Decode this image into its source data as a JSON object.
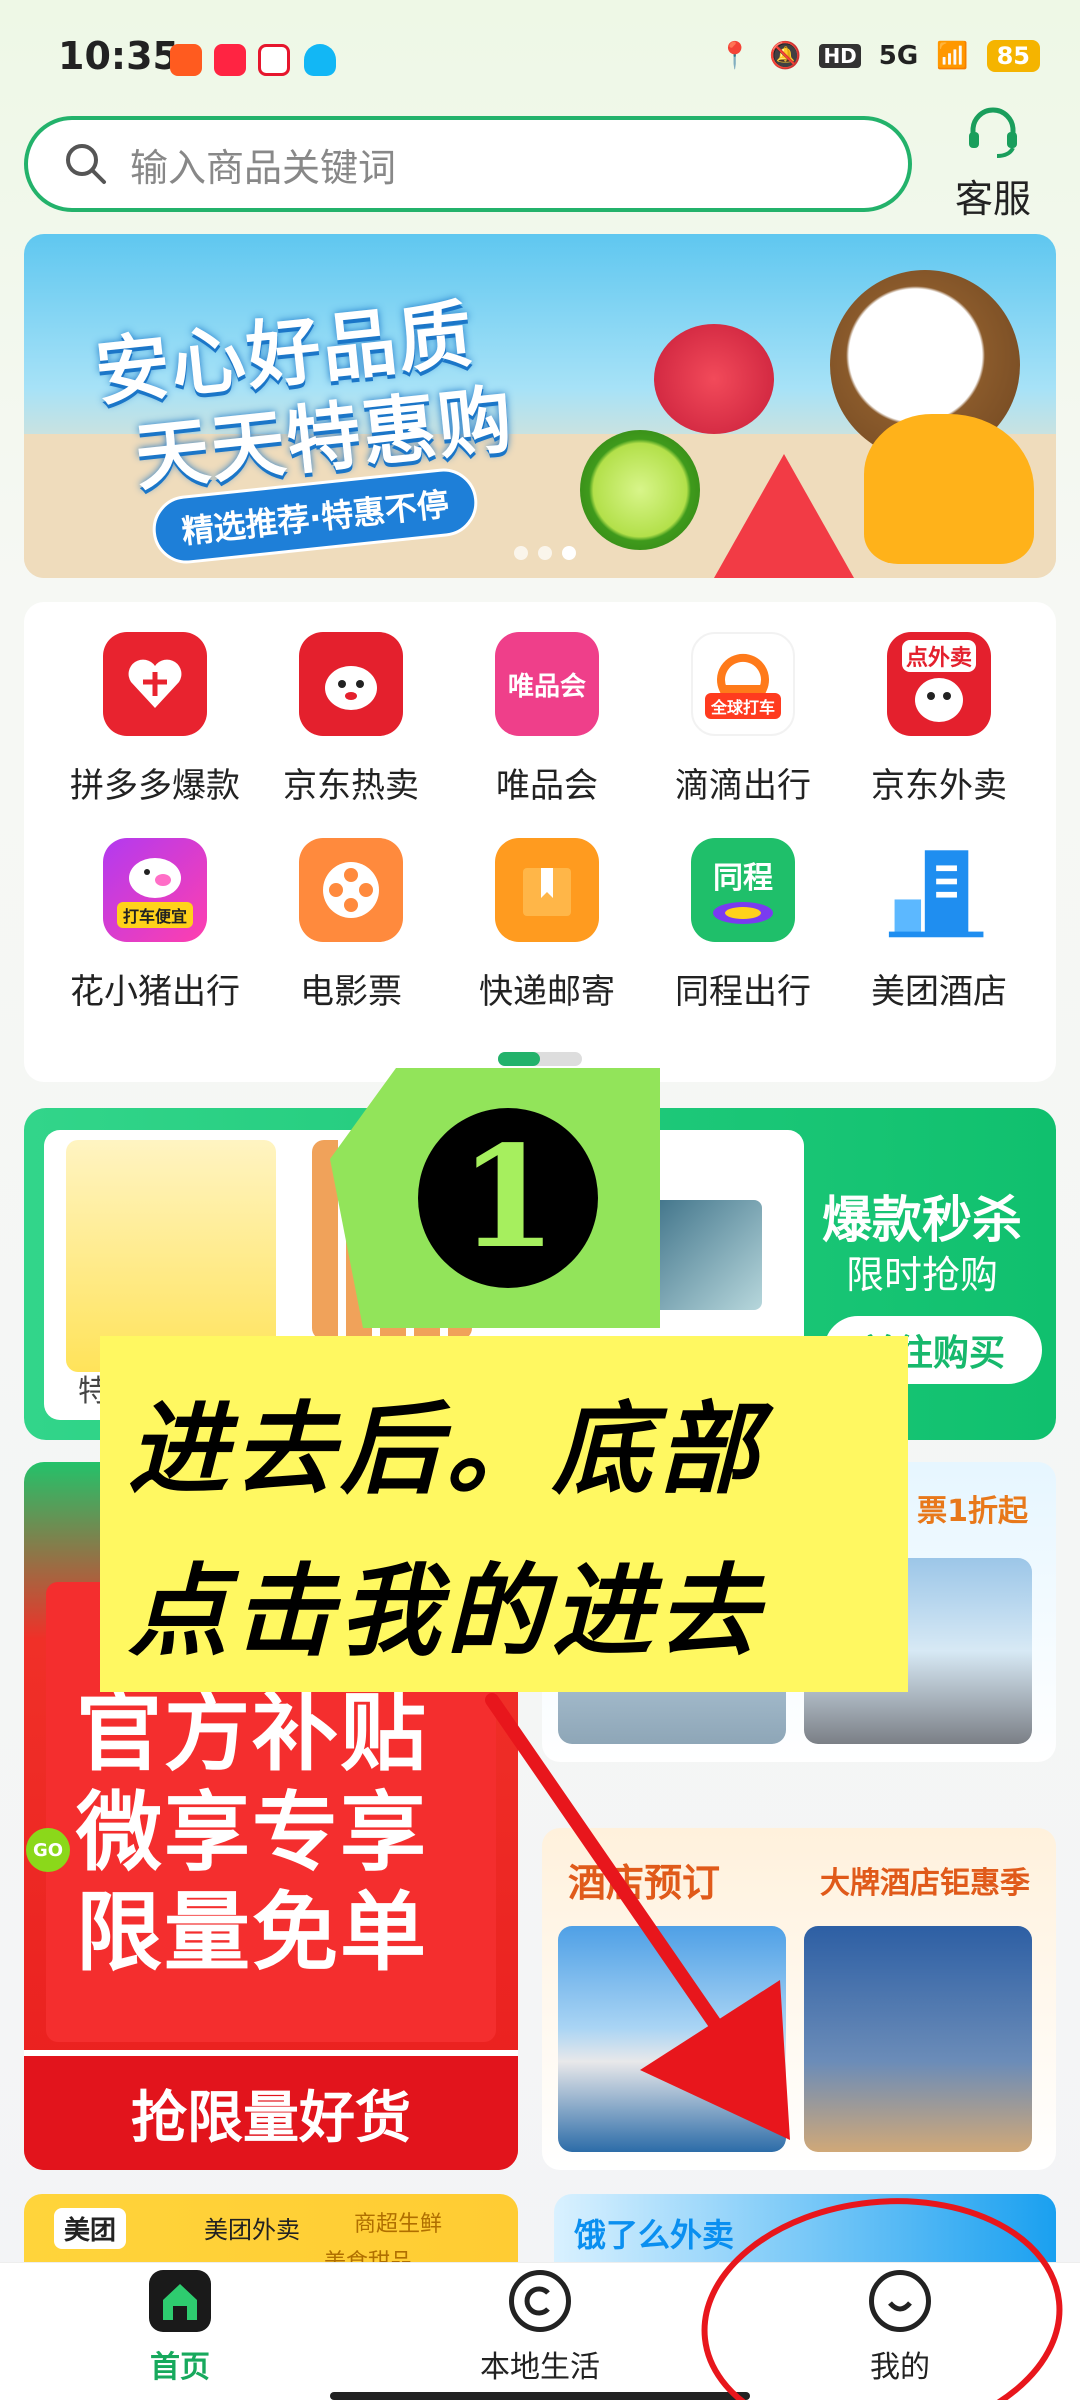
{
  "status": {
    "time": "10:35",
    "battery": "85",
    "network": "5G"
  },
  "search": {
    "placeholder": "输入商品关键词"
  },
  "service": {
    "label": "客服"
  },
  "banner": {
    "line1": "安心好品质",
    "line2": "天天特惠购",
    "tag": "精选推荐·特惠不停"
  },
  "grid": {
    "items": [
      {
        "label": "拼多多爆款",
        "icon": "pinduoduo-icon",
        "color": "#e8232f"
      },
      {
        "label": "京东热卖",
        "icon": "jd-dog-icon",
        "color": "#e4202d"
      },
      {
        "label": "唯品会",
        "icon": "vip-icon",
        "color": "#ef3f8a",
        "text": "唯品会"
      },
      {
        "label": "滴滴出行",
        "icon": "didi-icon",
        "color": "#ff7a1a",
        "text": "全球打车"
      },
      {
        "label": "京东外卖",
        "icon": "jd-takeout-icon",
        "color": "#e4202d",
        "text": "点外卖"
      },
      {
        "label": "花小猪出行",
        "icon": "pig-icon",
        "color": "#8a3bf0",
        "text": "打车便宜"
      },
      {
        "label": "电影票",
        "icon": "film-reel-icon",
        "color": "#ff8a3d"
      },
      {
        "label": "快递邮寄",
        "icon": "package-icon",
        "color": "#ff9b1f"
      },
      {
        "label": "同程出行",
        "icon": "tongcheng-icon",
        "color": "#1fbf6a",
        "text": "同程"
      },
      {
        "label": "美团酒店",
        "icon": "hotel-building-icon",
        "color": "#1f8ef0"
      }
    ]
  },
  "flash": {
    "title": "爆款秒杀",
    "subtitle": "限时抢购",
    "button": "前往购买",
    "tag": "特"
  },
  "promo": {
    "line1": "官方补贴",
    "line2": "微享专享",
    "line3": "限量免单",
    "button": "抢限量好货",
    "go": "GO"
  },
  "card_travel": {
    "tag": "票1折起"
  },
  "card_hotel": {
    "title": "酒店预订",
    "tag": "大牌酒店钜惠季"
  },
  "bottom_promos": {
    "meituan": "美团",
    "meituan_takeout": "美团外卖",
    "shop": "商超生鲜",
    "dessert": "美食甜品",
    "eleme": "饿了么外卖"
  },
  "tabs": [
    {
      "label": "首页",
      "icon": "home-icon",
      "active": true
    },
    {
      "label": "本地生活",
      "icon": "local-life-icon"
    },
    {
      "label": "我的",
      "icon": "profile-icon"
    }
  ],
  "overlay": {
    "number": "1",
    "line1": "进去后。底部",
    "line2": "点击我的进去"
  },
  "colors": {
    "accent": "#23b26b",
    "annotation": "#e8161c",
    "highlight": "#fff861"
  }
}
